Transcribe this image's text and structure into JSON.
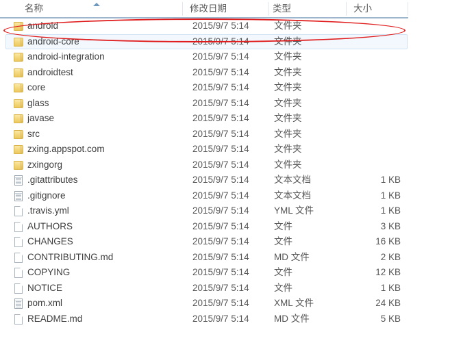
{
  "columns": [
    {
      "key": "name",
      "label": "名称"
    },
    {
      "key": "date",
      "label": "修改日期"
    },
    {
      "key": "type",
      "label": "类型"
    },
    {
      "key": "size",
      "label": "大小"
    }
  ],
  "sort": {
    "column": "名称",
    "direction": "ascending",
    "icon": "sort-ascending-arrow-icon"
  },
  "rows": [
    {
      "icon": "folder-icon",
      "name": "android",
      "date": "2015/9/7 5:14",
      "type": "文件夹",
      "size": "",
      "selected": false,
      "annotated": true
    },
    {
      "icon": "folder-icon",
      "name": "android-core",
      "date": "2015/9/7 5:14",
      "type": "文件夹",
      "size": "",
      "selected": true,
      "annotated": false
    },
    {
      "icon": "folder-icon",
      "name": "android-integration",
      "date": "2015/9/7 5:14",
      "type": "文件夹",
      "size": "",
      "selected": false,
      "annotated": false
    },
    {
      "icon": "folder-icon",
      "name": "androidtest",
      "date": "2015/9/7 5:14",
      "type": "文件夹",
      "size": "",
      "selected": false,
      "annotated": false
    },
    {
      "icon": "folder-icon",
      "name": "core",
      "date": "2015/9/7 5:14",
      "type": "文件夹",
      "size": "",
      "selected": false,
      "annotated": false
    },
    {
      "icon": "folder-icon",
      "name": "glass",
      "date": "2015/9/7 5:14",
      "type": "文件夹",
      "size": "",
      "selected": false,
      "annotated": false
    },
    {
      "icon": "folder-icon",
      "name": "javase",
      "date": "2015/9/7 5:14",
      "type": "文件夹",
      "size": "",
      "selected": false,
      "annotated": false
    },
    {
      "icon": "folder-icon",
      "name": "src",
      "date": "2015/9/7 5:14",
      "type": "文件夹",
      "size": "",
      "selected": false,
      "annotated": false
    },
    {
      "icon": "folder-icon",
      "name": "zxing.appspot.com",
      "date": "2015/9/7 5:14",
      "type": "文件夹",
      "size": "",
      "selected": false,
      "annotated": false
    },
    {
      "icon": "folder-icon",
      "name": "zxingorg",
      "date": "2015/9/7 5:14",
      "type": "文件夹",
      "size": "",
      "selected": false,
      "annotated": false
    },
    {
      "icon": "text-file-icon",
      "name": ".gitattributes",
      "date": "2015/9/7 5:14",
      "type": "文本文档",
      "size": "1 KB",
      "selected": false,
      "annotated": false
    },
    {
      "icon": "text-file-icon",
      "name": ".gitignore",
      "date": "2015/9/7 5:14",
      "type": "文本文档",
      "size": "1 KB",
      "selected": false,
      "annotated": false
    },
    {
      "icon": "file-icon",
      "name": ".travis.yml",
      "date": "2015/9/7 5:14",
      "type": "YML 文件",
      "size": "1 KB",
      "selected": false,
      "annotated": false
    },
    {
      "icon": "file-icon",
      "name": "AUTHORS",
      "date": "2015/9/7 5:14",
      "type": "文件",
      "size": "3 KB",
      "selected": false,
      "annotated": false
    },
    {
      "icon": "file-icon",
      "name": "CHANGES",
      "date": "2015/9/7 5:14",
      "type": "文件",
      "size": "16 KB",
      "selected": false,
      "annotated": false
    },
    {
      "icon": "file-icon",
      "name": "CONTRIBUTING.md",
      "date": "2015/9/7 5:14",
      "type": "MD 文件",
      "size": "2 KB",
      "selected": false,
      "annotated": false
    },
    {
      "icon": "file-icon",
      "name": "COPYING",
      "date": "2015/9/7 5:14",
      "type": "文件",
      "size": "12 KB",
      "selected": false,
      "annotated": false
    },
    {
      "icon": "file-icon",
      "name": "NOTICE",
      "date": "2015/9/7 5:14",
      "type": "文件",
      "size": "1 KB",
      "selected": false,
      "annotated": false
    },
    {
      "icon": "text-file-icon",
      "name": "pom.xml",
      "date": "2015/9/7 5:14",
      "type": "XML 文件",
      "size": "24 KB",
      "selected": false,
      "annotated": false
    },
    {
      "icon": "file-icon",
      "name": "README.md",
      "date": "2015/9/7 5:14",
      "type": "MD 文件",
      "size": "5 KB",
      "selected": false,
      "annotated": false
    }
  ],
  "annotation": {
    "shape": "ellipse",
    "color": "#e01b1b",
    "target": "android"
  },
  "colors": {
    "header_underline": "#9eb6cd",
    "selection_fill": "#f2f8fd",
    "selection_border": "#cfe3f5",
    "annotation": "#e01b1b",
    "text": "#3d3d3d"
  }
}
